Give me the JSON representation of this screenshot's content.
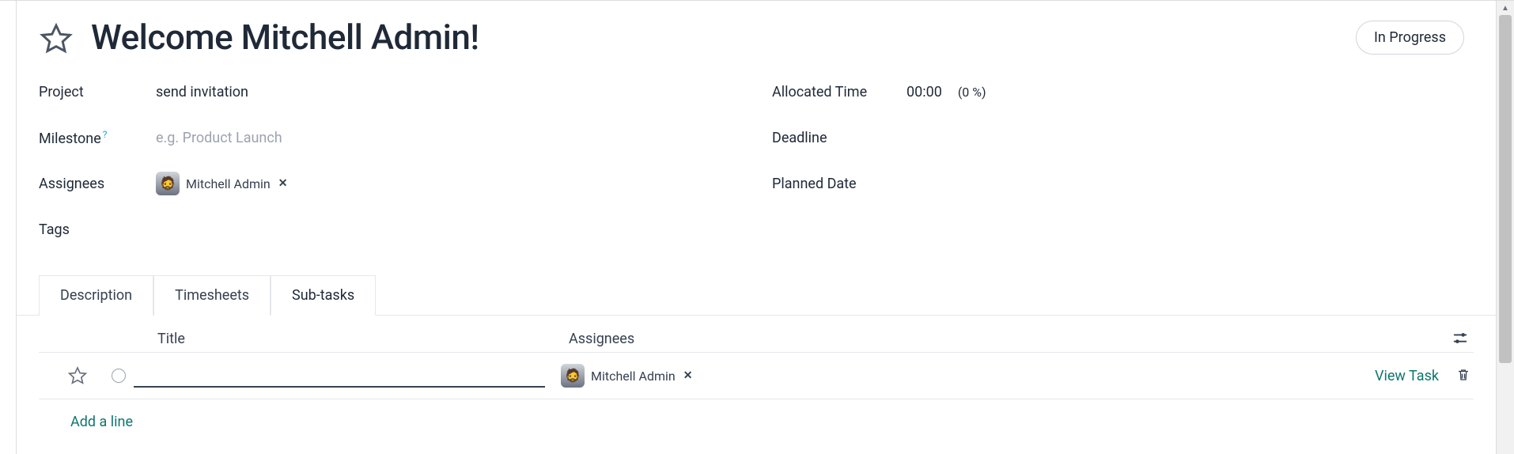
{
  "title": "Welcome Mitchell Admin!",
  "status": "In Progress",
  "fields": {
    "project_label": "Project",
    "project_value": "send invitation",
    "milestone_label": "Milestone",
    "milestone_placeholder": "e.g. Product Launch",
    "assignees_label": "Assignees",
    "tags_label": "Tags",
    "allocated_time_label": "Allocated Time",
    "allocated_time_value": "00:00",
    "allocated_time_pct": "(0 %)",
    "deadline_label": "Deadline",
    "planned_date_label": "Planned Date"
  },
  "assignee": {
    "name": "Mitchell Admin"
  },
  "tabs": {
    "description": "Description",
    "timesheets": "Timesheets",
    "subtasks": "Sub-tasks"
  },
  "subtasks": {
    "headers": {
      "title": "Title",
      "assignees": "Assignees"
    },
    "row_assignee": "Mitchell Admin",
    "view_task": "View Task",
    "add_line": "Add a line"
  }
}
